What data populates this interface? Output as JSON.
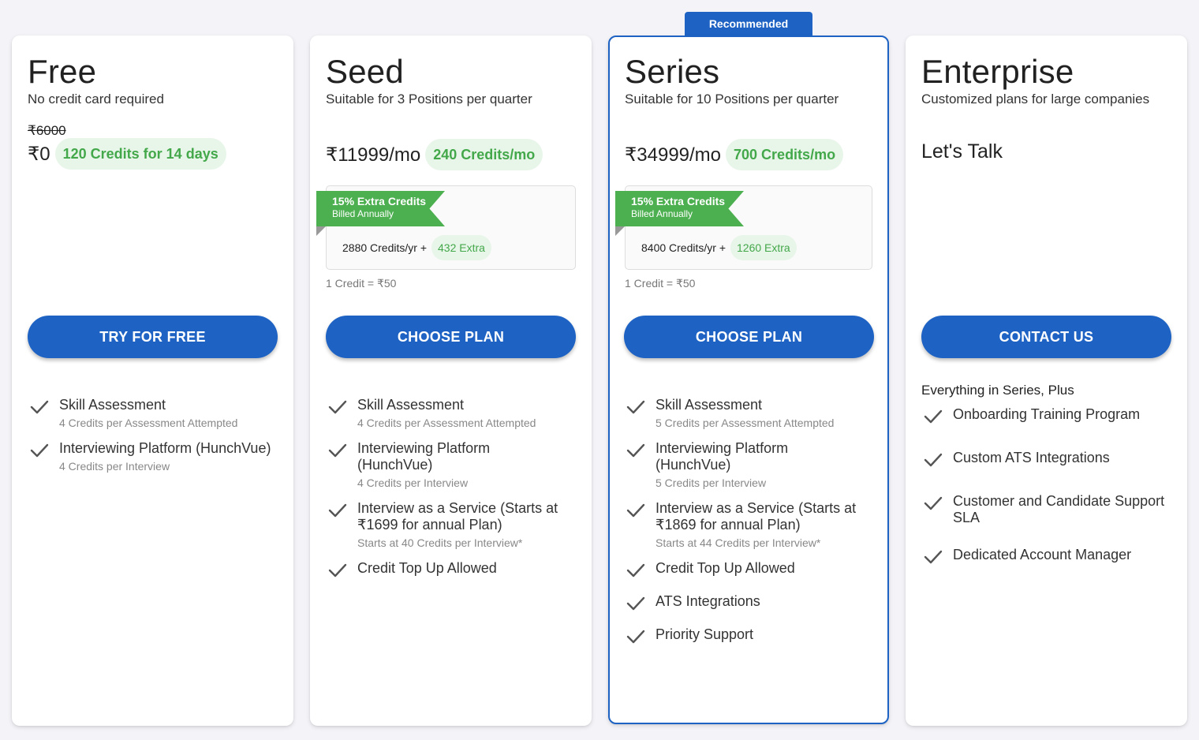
{
  "recommended_label": "Recommended",
  "colors": {
    "primary": "#1e63c4",
    "green": "#4caf50",
    "green_text": "#43a84a",
    "pill_bg": "#e8f5e9",
    "page_bg": "#f4f4f8"
  },
  "plans": {
    "free": {
      "name": "Free",
      "description": "No credit card required",
      "old_price": "₹6000",
      "price": "₹0",
      "credits": "120 Credits for 14 days",
      "cta": "TRY FOR FREE",
      "features": [
        {
          "title": "Skill Assessment",
          "sub": "4 Credits per Assessment Attempted"
        },
        {
          "title": "Interviewing Platform (HunchVue)",
          "sub": "4 Credits per Interview"
        }
      ]
    },
    "seed": {
      "name": "Seed",
      "description": "Suitable for 3 Positions per quarter",
      "price": "₹11999/mo",
      "credits": "240 Credits/mo",
      "ribbon_title": "15% Extra Credits",
      "ribbon_sub": "Billed Annually",
      "annual_credits": "2880 Credits/yr +",
      "annual_extra": "432 Extra",
      "credit_rate": "1 Credit = ₹50",
      "cta": "CHOOSE PLAN",
      "features": [
        {
          "title": "Skill Assessment",
          "sub": "4 Credits per Assessment Attempted"
        },
        {
          "title": "Interviewing Platform (HunchVue)",
          "sub": "4 Credits per Interview"
        },
        {
          "title": "Interview as a Service (Starts at ₹1699 for annual Plan)",
          "sub": "Starts at 40 Credits per Interview*"
        },
        {
          "title": "Credit Top Up Allowed",
          "sub": ""
        }
      ]
    },
    "series": {
      "name": "Series",
      "description": "Suitable for 10 Positions per quarter",
      "price": "₹34999/mo",
      "credits": "700 Credits/mo",
      "ribbon_title": "15% Extra Credits",
      "ribbon_sub": "Billed Annually",
      "annual_credits": "8400 Credits/yr +",
      "annual_extra": "1260 Extra",
      "credit_rate": "1 Credit = ₹50",
      "cta": "CHOOSE PLAN",
      "features": [
        {
          "title": "Skill Assessment",
          "sub": "5 Credits per Assessment Attempted"
        },
        {
          "title": "Interviewing Platform (HunchVue)",
          "sub": "5 Credits per Interview"
        },
        {
          "title": "Interview as a Service (Starts at ₹1869 for annual Plan)",
          "sub": "Starts at 44 Credits per Interview*"
        },
        {
          "title": "Credit Top Up Allowed",
          "sub": ""
        },
        {
          "title": "ATS Integrations",
          "sub": ""
        },
        {
          "title": "Priority Support",
          "sub": ""
        }
      ]
    },
    "enterprise": {
      "name": "Enterprise",
      "description": "Customized plans for large companies",
      "price_text": "Let's Talk",
      "cta": "CONTACT US",
      "features_heading": "Everything in Series, Plus",
      "features": [
        {
          "title": "Onboarding Training Program",
          "sub": ""
        },
        {
          "title": "Custom ATS Integrations",
          "sub": ""
        },
        {
          "title": "Customer and Candidate Support SLA",
          "sub": ""
        },
        {
          "title": "Dedicated Account Manager",
          "sub": ""
        }
      ]
    }
  }
}
